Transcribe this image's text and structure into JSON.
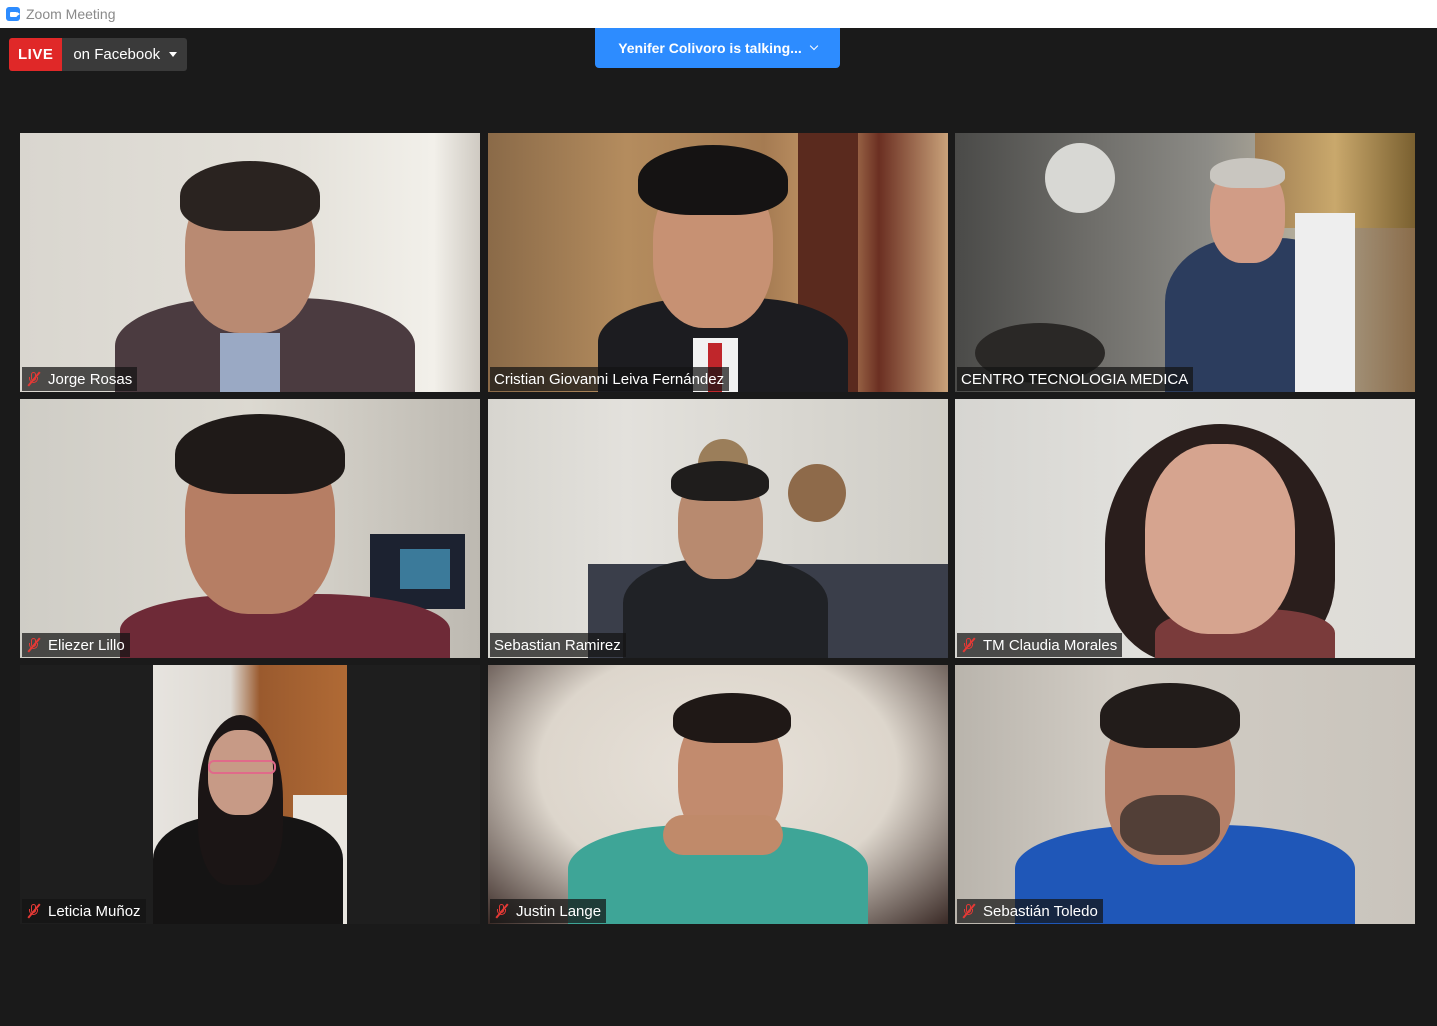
{
  "window": {
    "title": "Zoom Meeting"
  },
  "live": {
    "badge": "LIVE",
    "target": "on Facebook"
  },
  "speaker_banner": {
    "text": "Yenifer Colivoro is talking..."
  },
  "participants": [
    {
      "name": "Jorge Rosas",
      "muted": true
    },
    {
      "name": "Cristian Giovanni Leiva Fernández",
      "muted": false
    },
    {
      "name": "CENTRO TECNOLOGIA MEDICA",
      "muted": false
    },
    {
      "name": "Eliezer Lillo",
      "muted": true
    },
    {
      "name": "Sebastian Ramirez",
      "muted": false
    },
    {
      "name": "TM Claudia Morales",
      "muted": true
    },
    {
      "name": "Leticia Muñoz",
      "muted": true
    },
    {
      "name": "Justin Lange",
      "muted": true
    },
    {
      "name": "Sebastián Toledo",
      "muted": true
    }
  ],
  "colors": {
    "background": "#1a1a1a",
    "accent": "#2d8cff",
    "live_red": "#e02828",
    "mute_red": "#e53935"
  }
}
